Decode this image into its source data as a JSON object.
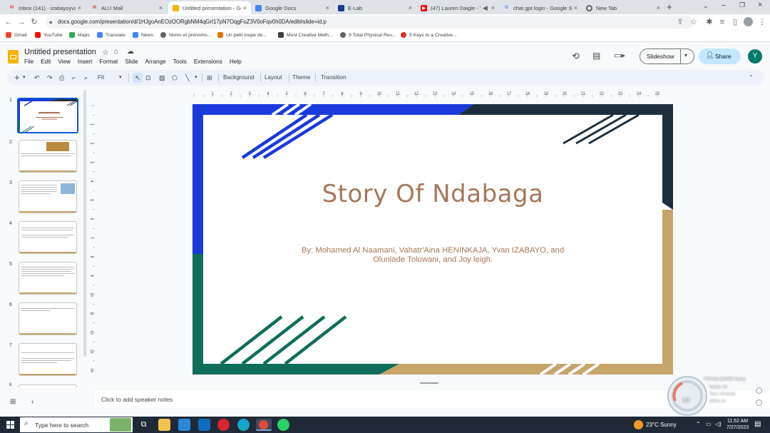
{
  "browser": {
    "tabs": [
      {
        "title": "Inbox (141) - izabayoyvan...",
        "icon": "gmail-icon",
        "color": "#ea4335"
      },
      {
        "title": "ALU Mail",
        "icon": "gmail-icon",
        "color": "#ea4335"
      },
      {
        "title": "Untitled presentation - Go...",
        "icon": "slides-icon",
        "color": "#f4b400",
        "active": true
      },
      {
        "title": "Google Docs",
        "icon": "docs-icon",
        "color": "#4285f4"
      },
      {
        "title": "E-Lab",
        "icon": "elab-icon",
        "color": "#1a3a8a"
      },
      {
        "title": "(47) Lauren Daigle - Yo...",
        "icon": "youtube-icon",
        "color": "#ff0000"
      },
      {
        "title": "chat gpt login - Google Se...",
        "icon": "google-icon",
        "color": "#4285f4"
      },
      {
        "title": "New Tab",
        "icon": "chrome-icon",
        "color": "#5f6368"
      }
    ],
    "url": "docs.google.com/presentation/d/1HJgoAnEOzOORgbNM4qGrI17pN7OqgFuZ3V0oFqv0h0DA/edit#slide=id.p",
    "bookmarks": [
      {
        "label": "Gmail",
        "color": "#ea4335"
      },
      {
        "label": "YouTube",
        "color": "#ff0000"
      },
      {
        "label": "Maps",
        "color": "#34a853"
      },
      {
        "label": "Translate",
        "color": "#4285f4"
      },
      {
        "label": "News",
        "color": "#4285f4"
      },
      {
        "label": "Noms et prénoms...",
        "color": "#5f6368"
      },
      {
        "label": "Un petit loupe de...",
        "color": "#e37400"
      },
      {
        "label": "Most Creative Meth...",
        "color": "#3c4043"
      },
      {
        "label": "9 Total Physical Res...",
        "color": "#5f6368"
      },
      {
        "label": "5 Keys to a Creative...",
        "color": "#d93025"
      }
    ]
  },
  "doc": {
    "title": "Untitled presentation",
    "menu": [
      "File",
      "Edit",
      "View",
      "Insert",
      "Format",
      "Slide",
      "Arrange",
      "Tools",
      "Extensions",
      "Help"
    ],
    "slideshow_label": "Slideshow",
    "share_label": "Share",
    "avatar_letter": "Y",
    "toolbar": {
      "zoom": "Fit",
      "background": "Background",
      "layout": "Layout",
      "theme": "Theme",
      "transition": "Transition"
    }
  },
  "filmstrip": {
    "numbers": [
      "1",
      "2",
      "3",
      "4",
      "5",
      "6",
      "7",
      "8"
    ]
  },
  "ruler": {
    "h": [
      "1",
      "2",
      "3",
      "4",
      "5",
      "6",
      "7",
      "8",
      "9",
      "10",
      "11",
      "12",
      "13",
      "14",
      "15",
      "16",
      "17",
      "18",
      "19",
      "20",
      "21",
      "22",
      "23",
      "24",
      "25"
    ],
    "v": [
      "1",
      "2",
      "3",
      "4",
      "5",
      "6",
      "7",
      "8",
      "9",
      "10",
      "11",
      "12",
      "13",
      "14"
    ]
  },
  "slide": {
    "title": "Story Of Ndabaga",
    "subtitle_line1": "By: Mohamed Al Naamani, Vahatr'Aina HENINKAJA, Yvan IZABAYO, and",
    "subtitle_line2": "Olunlade Toluwani, and Joy leigh.",
    "colors": {
      "blue": "#1a3adb",
      "teal": "#0e6e5a",
      "dark": "#1d2f3d",
      "gold": "#c6a46a",
      "title": "#a5775a"
    }
  },
  "notes_placeholder": "Click to add speaker notes",
  "taskbar": {
    "search_placeholder": "Type here to search",
    "weather": "23°C  Sunny",
    "time": "11:52 AM",
    "date": "7/27/2023",
    "typing_meter": {
      "title": "TYPING METER Today",
      "words": "Words: 30",
      "time": "Time: 00:02:56",
      "wpm": "WPM: 13",
      "gauge": "00"
    }
  }
}
